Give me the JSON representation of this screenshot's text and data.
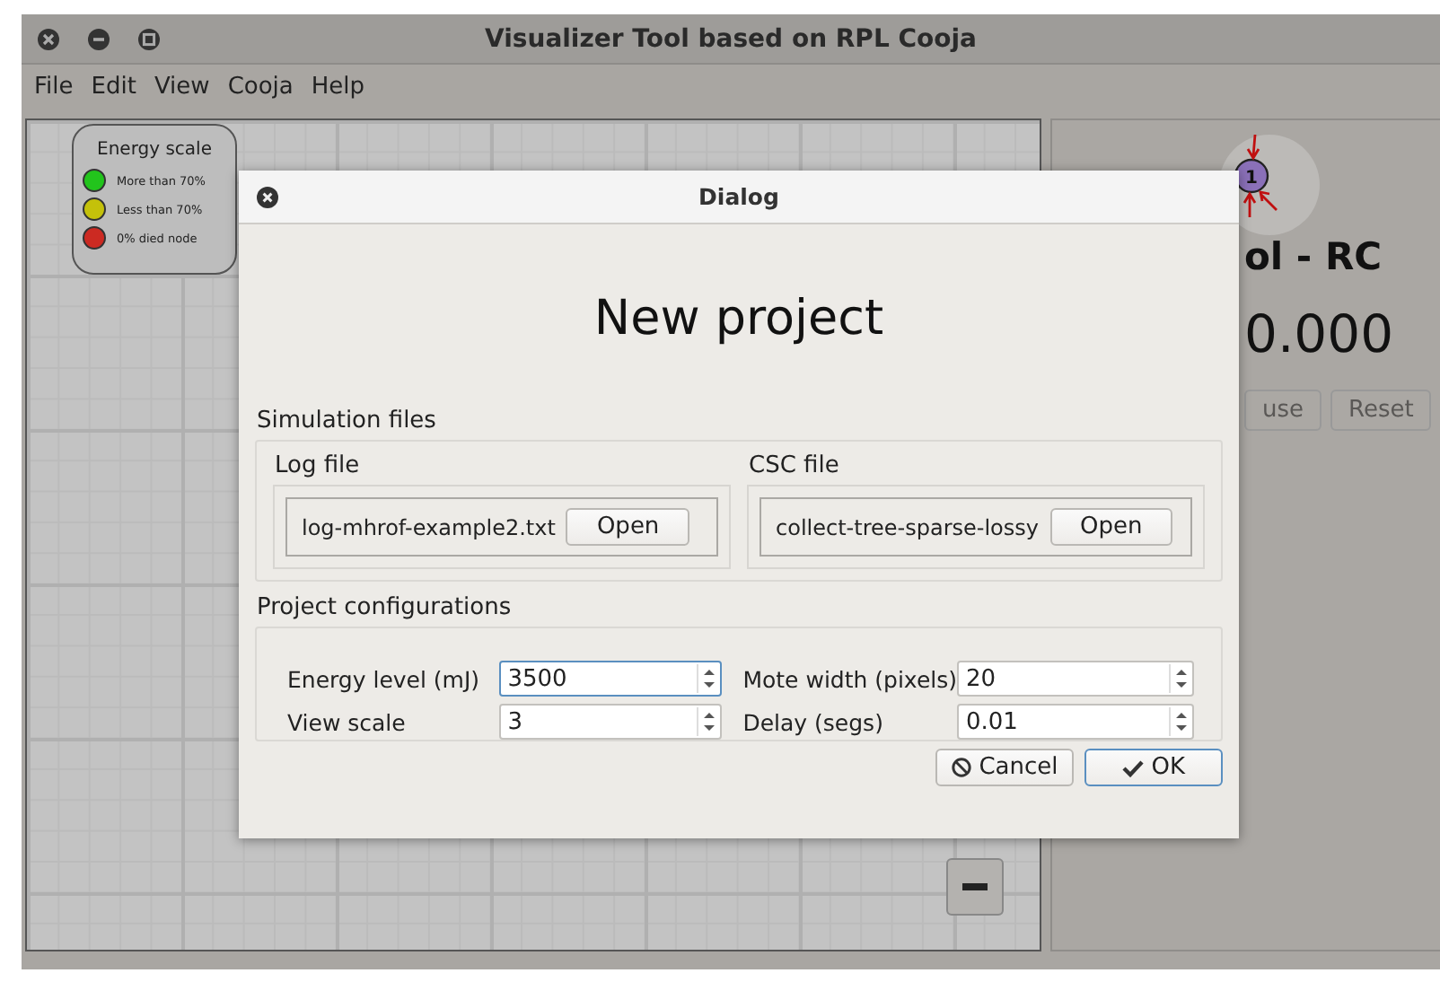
{
  "window": {
    "title": "Visualizer Tool based on RPL Cooja"
  },
  "menu": [
    "File",
    "Edit",
    "View",
    "Cooja",
    "Help"
  ],
  "legend": {
    "title": "Energy scale",
    "items": [
      {
        "label": "More than 70%",
        "color": "#22c41c"
      },
      {
        "label": "Less than 70%",
        "color": "#c4c10a"
      },
      {
        "label": "0% died node",
        "color": "#cc2a22"
      }
    ]
  },
  "node": {
    "label": "1"
  },
  "panel": {
    "title": "ol - RC",
    "timer": "0.000",
    "buttons": [
      {
        "label": "use",
        "disabled": true
      },
      {
        "label": "Reset",
        "disabled": true
      }
    ]
  },
  "dialog": {
    "title": "Dialog",
    "heading": "New project",
    "simulation_files": {
      "title": "Simulation files",
      "groups": [
        {
          "title": "Log file",
          "file": "log-mhrof-example2.txt",
          "button": "Open"
        },
        {
          "title": "CSC file",
          "file": "collect-tree-sparse-lossy",
          "button": "Open"
        }
      ]
    },
    "configurations": {
      "title": "Project configurations",
      "fields": [
        {
          "label": "Energy level (mJ)",
          "value": "3500",
          "focused": true
        },
        {
          "label": "Mote width (pixels)",
          "value": "20",
          "focused": false
        },
        {
          "label": "View scale",
          "value": "3",
          "focused": false
        },
        {
          "label": "Delay (segs)",
          "value": "0.01",
          "focused": false
        }
      ]
    },
    "buttons": [
      {
        "kind": "cancel",
        "label": "Cancel",
        "default": false
      },
      {
        "kind": "ok",
        "label": "OK",
        "default": true
      }
    ]
  }
}
